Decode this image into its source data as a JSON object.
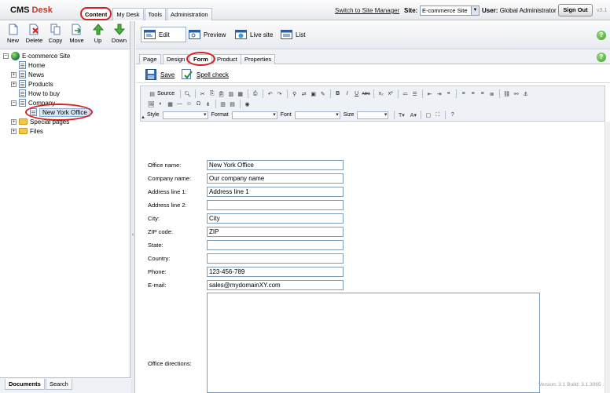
{
  "header": {
    "logo_main": "CMS",
    "logo_accent": "Desk",
    "tabs": [
      "Content",
      "My Desk",
      "Tools",
      "Administration"
    ],
    "site_manager_link": "Switch to Site Manager",
    "site_label": "Site:",
    "site_value": "E-commerce Site",
    "user_label": "User:",
    "user_name": "Global Administrator",
    "sign_out": "Sign Out",
    "version": "v3.1"
  },
  "tree_toolbar": [
    "New",
    "Delete",
    "Copy",
    "Move",
    "Up",
    "Down"
  ],
  "tree": {
    "root": "E-commerce Site",
    "items": [
      "Home",
      "News",
      "Products",
      "How to buy",
      "Company",
      "New York Office",
      "Special pages",
      "Files"
    ]
  },
  "left_tabs": [
    "Documents",
    "Search"
  ],
  "view_modes": [
    "Edit",
    "Preview",
    "Live site",
    "List"
  ],
  "sub_tabs": [
    "Page",
    "Design",
    "Form",
    "Product",
    "Properties"
  ],
  "actions": {
    "save": "Save",
    "spell_check": "Spell check"
  },
  "editor": {
    "source_label": "Source",
    "style_label": "Style",
    "format_label": "Format",
    "font_label": "Font",
    "size_label": "Size"
  },
  "form": {
    "fields": [
      {
        "label": "Office name:",
        "value": "New York Office"
      },
      {
        "label": "Company name:",
        "value": "Our company name"
      },
      {
        "label": "Address line 1:",
        "value": "Address line 1"
      },
      {
        "label": "Address line 2:",
        "value": ""
      },
      {
        "label": "City:",
        "value": "City"
      },
      {
        "label": "ZIP code:",
        "value": "ZIP"
      },
      {
        "label": "State:",
        "value": ""
      },
      {
        "label": "Country:",
        "value": ""
      },
      {
        "label": "Phone:",
        "value": "123-456-789"
      },
      {
        "label": "E-mail:",
        "value": "sales@mydomainXY.com"
      }
    ],
    "directions_label": "Office directions:"
  },
  "footer": {
    "version": "Version: 3.1 Build: 3.1.3065"
  },
  "colors": {
    "accent_red": "#d42020",
    "link_blue": "#1f5e9c",
    "panel": "#eef1f5"
  }
}
